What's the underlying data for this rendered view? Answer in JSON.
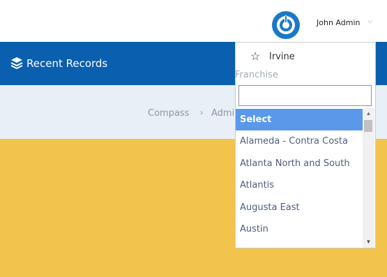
{
  "header": {
    "user_name": "John Admin",
    "user_caret": "⌵"
  },
  "nav": {
    "title": "Recent Records"
  },
  "breadcrumb": {
    "items": [
      "Compass",
      "Admi"
    ],
    "separator": "›"
  },
  "dropdown": {
    "location": "Irvine",
    "star_glyph": "☆",
    "field_label": "Franchise",
    "search_value": "",
    "options": [
      "Select",
      "Alameda - Contra Costa",
      "Atlanta North and South",
      "Atlantis",
      "Augusta East",
      "Austin"
    ],
    "selected_index": 0,
    "scroll_up_glyph": "▲",
    "scroll_down_glyph": "▼"
  },
  "colors": {
    "brand_blue": "#0a5fae",
    "logo_blue": "#1b78c6",
    "selected_option": "#5b98ea",
    "breadcrumb_bg": "#e9eff6",
    "content_yellow": "#f2c44b"
  }
}
